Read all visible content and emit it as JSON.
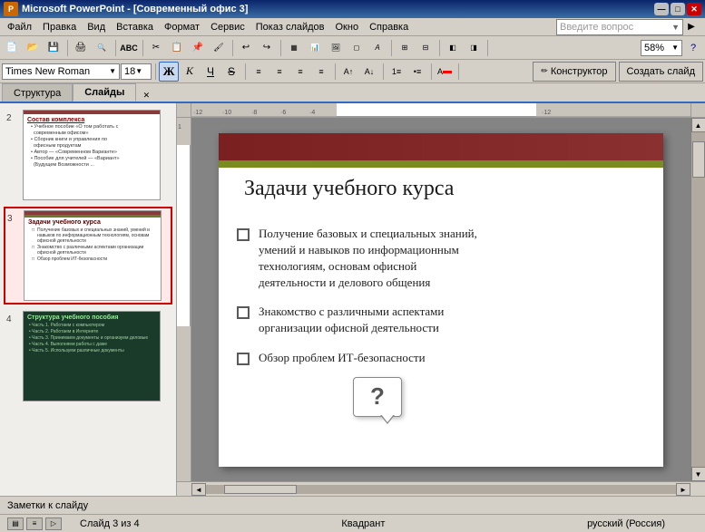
{
  "titleBar": {
    "icon": "P",
    "text": "Microsoft PowerPoint - [Современный офис 3]",
    "minBtn": "—",
    "maxBtn": "□",
    "closeBtn": "✕"
  },
  "menuBar": {
    "items": [
      "Файл",
      "Правка",
      "Вид",
      "Вставка",
      "Формат",
      "Сервис",
      "Показ слайдов",
      "Окно",
      "Справка"
    ]
  },
  "toolbar1": {
    "helpPlaceholder": "Введите вопрос",
    "zoom": "58%"
  },
  "toolbar2": {
    "fontName": "Times New Roman",
    "fontSize": "18",
    "boldLabel": "Ж",
    "italicLabel": "К",
    "underlineLabel": "Ч",
    "strikeLabel": "S",
    "designerLabel": "Конструктор",
    "newSlideLabel": "Создать слайд"
  },
  "tabs": {
    "structure": "Структура",
    "slides": "Слайды"
  },
  "slides": [
    {
      "num": "2",
      "title": "Состав комплекса",
      "bullets": [
        "Учебное пособие «О том работать с современным офисом»",
        "Сборник книги и управления по офисным продуктам",
        "Автор — «Современном Варианте»",
        "Пособие для учителей — «Вариант» (Будущем Возможности ..."
      ]
    },
    {
      "num": "3",
      "title": "Задачи учебного курса",
      "bullets": [
        "Получение базовых и специальных знаний, умений и навыков по информационным технологиям, основам офисной деятельности",
        "Знакомство с различными аспектами организации офисной деятельности",
        "Обзор проблем ИТ-безопасности"
      ]
    },
    {
      "num": "4",
      "title": "Структура учебного пособия",
      "bullets": [
        "Часть 1. Работаем с компьютером",
        "Часть 2. Работаем в Интернете",
        "Часть 3. Принимаем документы и организуем деловые проблемы",
        "Часть 4. Выполняем работы с даже",
        "Часть 5. Используем различные документы"
      ]
    }
  ],
  "mainSlide": {
    "title": "Задачи учебного курса",
    "bullets": [
      "Получение базовых и специальных знаний, умений и навыков по информационным технологиям, основам офисной деятельности и делового общения",
      "Знакомство с различными аспектами организации офисной деятельности",
      "Обзор проблем ИТ-безопасности"
    ],
    "callout": "?"
  },
  "notesBar": "Заметки к слайду",
  "statusBar": {
    "slideInfo": "Слайд 3 из 4",
    "section": "Квадрант",
    "language": "русский (Россия)"
  }
}
